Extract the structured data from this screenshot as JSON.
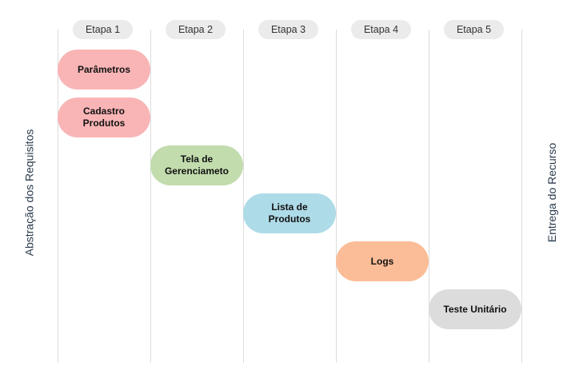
{
  "colors": {
    "pink": "#f9b5b6",
    "green": "#c2dcad",
    "blue": "#aedbe8",
    "orange": "#fbbd97",
    "gray": "#dcdcdc",
    "stage_bg": "#ebebeb",
    "side_text": "#2a3b4c"
  },
  "stages": [
    "Etapa 1",
    "Etapa 2",
    "Etapa 3",
    "Etapa 4",
    "Etapa 5"
  ],
  "tasks": [
    {
      "label": "Parâmetros",
      "stage": 1,
      "color": "pink"
    },
    {
      "label": "Cadastro\nProdutos",
      "stage": 1,
      "color": "pink"
    },
    {
      "label": "Tela de\nGerenciameto",
      "stage": 2,
      "color": "green"
    },
    {
      "label": "Lista de\nProdutos",
      "stage": 3,
      "color": "blue"
    },
    {
      "label": "Logs",
      "stage": 4,
      "color": "orange"
    },
    {
      "label": "Teste Unitário",
      "stage": 5,
      "color": "gray"
    }
  ],
  "left_label": "Abstração dos Requisitos",
  "right_label": "Entrega do Recurso"
}
